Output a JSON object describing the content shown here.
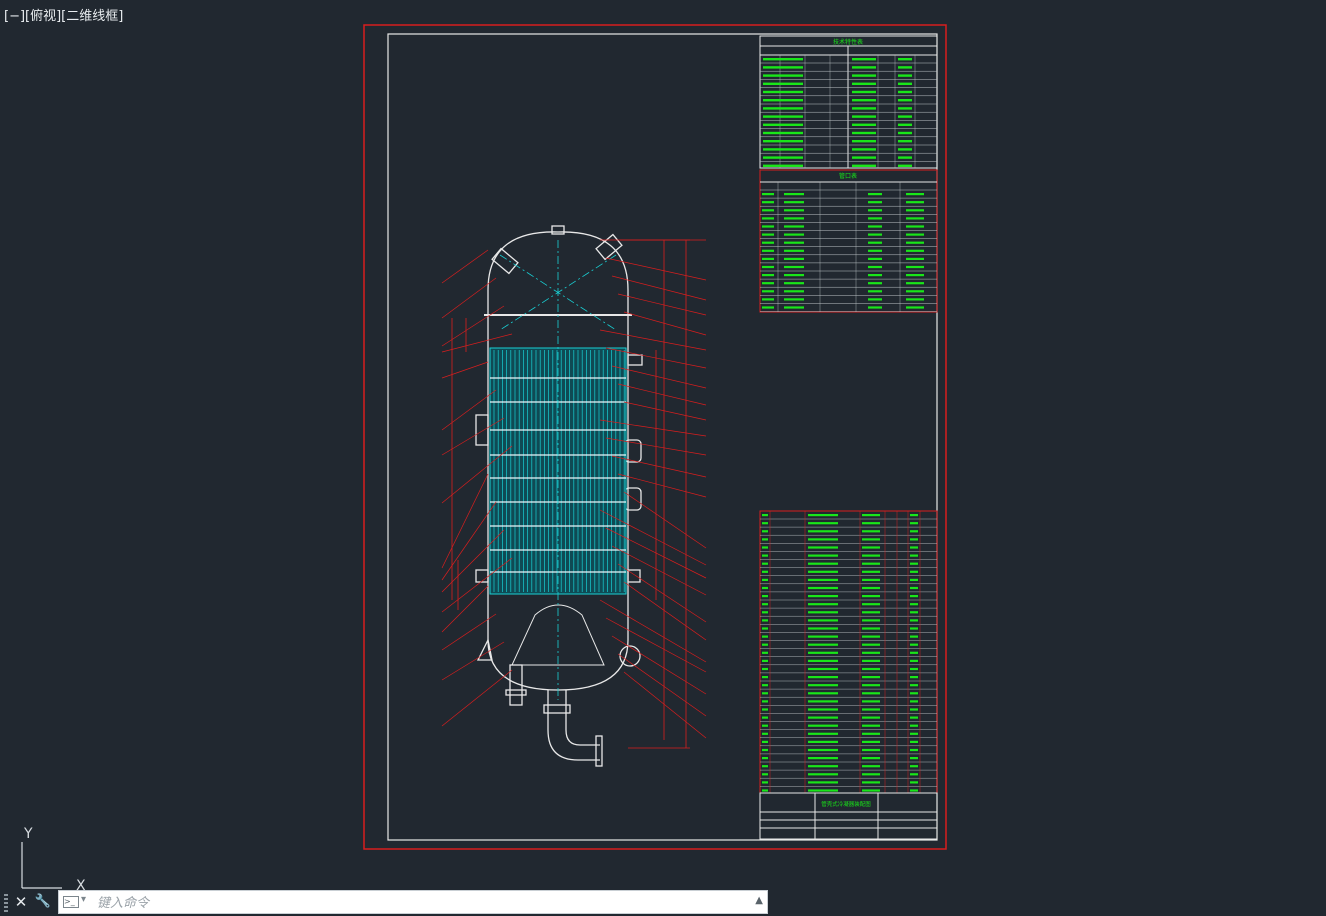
{
  "viewport": {
    "label": "[−][俯视][二维线框]"
  },
  "ucs": {
    "y_label": "Y",
    "x_label": "X"
  },
  "command_line": {
    "placeholder": "键入命令",
    "close_symbol": "✕",
    "settings_symbol": "🔧",
    "history_symbol": "▲"
  },
  "drawing": {
    "title": "管壳式冷凝器装配图",
    "tech_table_title": "技术特性表",
    "nozzle_table_title": "管口表",
    "colors": {
      "background": "#212830",
      "frame": "#d81e1e",
      "border": "#ffffff",
      "text": "#19e619",
      "tubes": "#19d0d4"
    }
  }
}
